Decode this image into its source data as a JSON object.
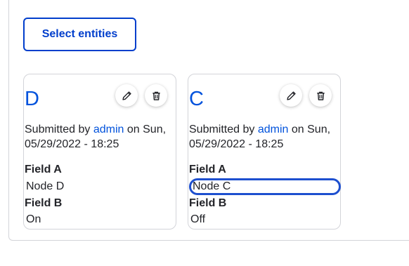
{
  "toolbar": {
    "select_label": "Select entities"
  },
  "cards": [
    {
      "title": "D",
      "submitted_prefix": "Submitted by",
      "author": "admin",
      "date_text": "on Sun, 05/29/2022 - 18:25",
      "field_a_label": "Field A",
      "field_a_value": "Node D",
      "field_b_label": "Field B",
      "field_b_value": "On"
    },
    {
      "title": "C",
      "submitted_prefix": "Submitted by",
      "author": "admin",
      "date_text": "on Sun, 05/29/2022 - 18:25",
      "field_a_label": "Field A",
      "field_a_value": "Node C",
      "field_b_label": "Field B",
      "field_b_value": "Off"
    }
  ],
  "icons": {
    "edit": "pencil-icon",
    "delete": "trash-icon"
  },
  "colors": {
    "link": "#0052dc",
    "button_border": "#003ecc",
    "focus_ring": "#1d4fcf",
    "border": "#d3d4d9",
    "text": "#232429"
  }
}
